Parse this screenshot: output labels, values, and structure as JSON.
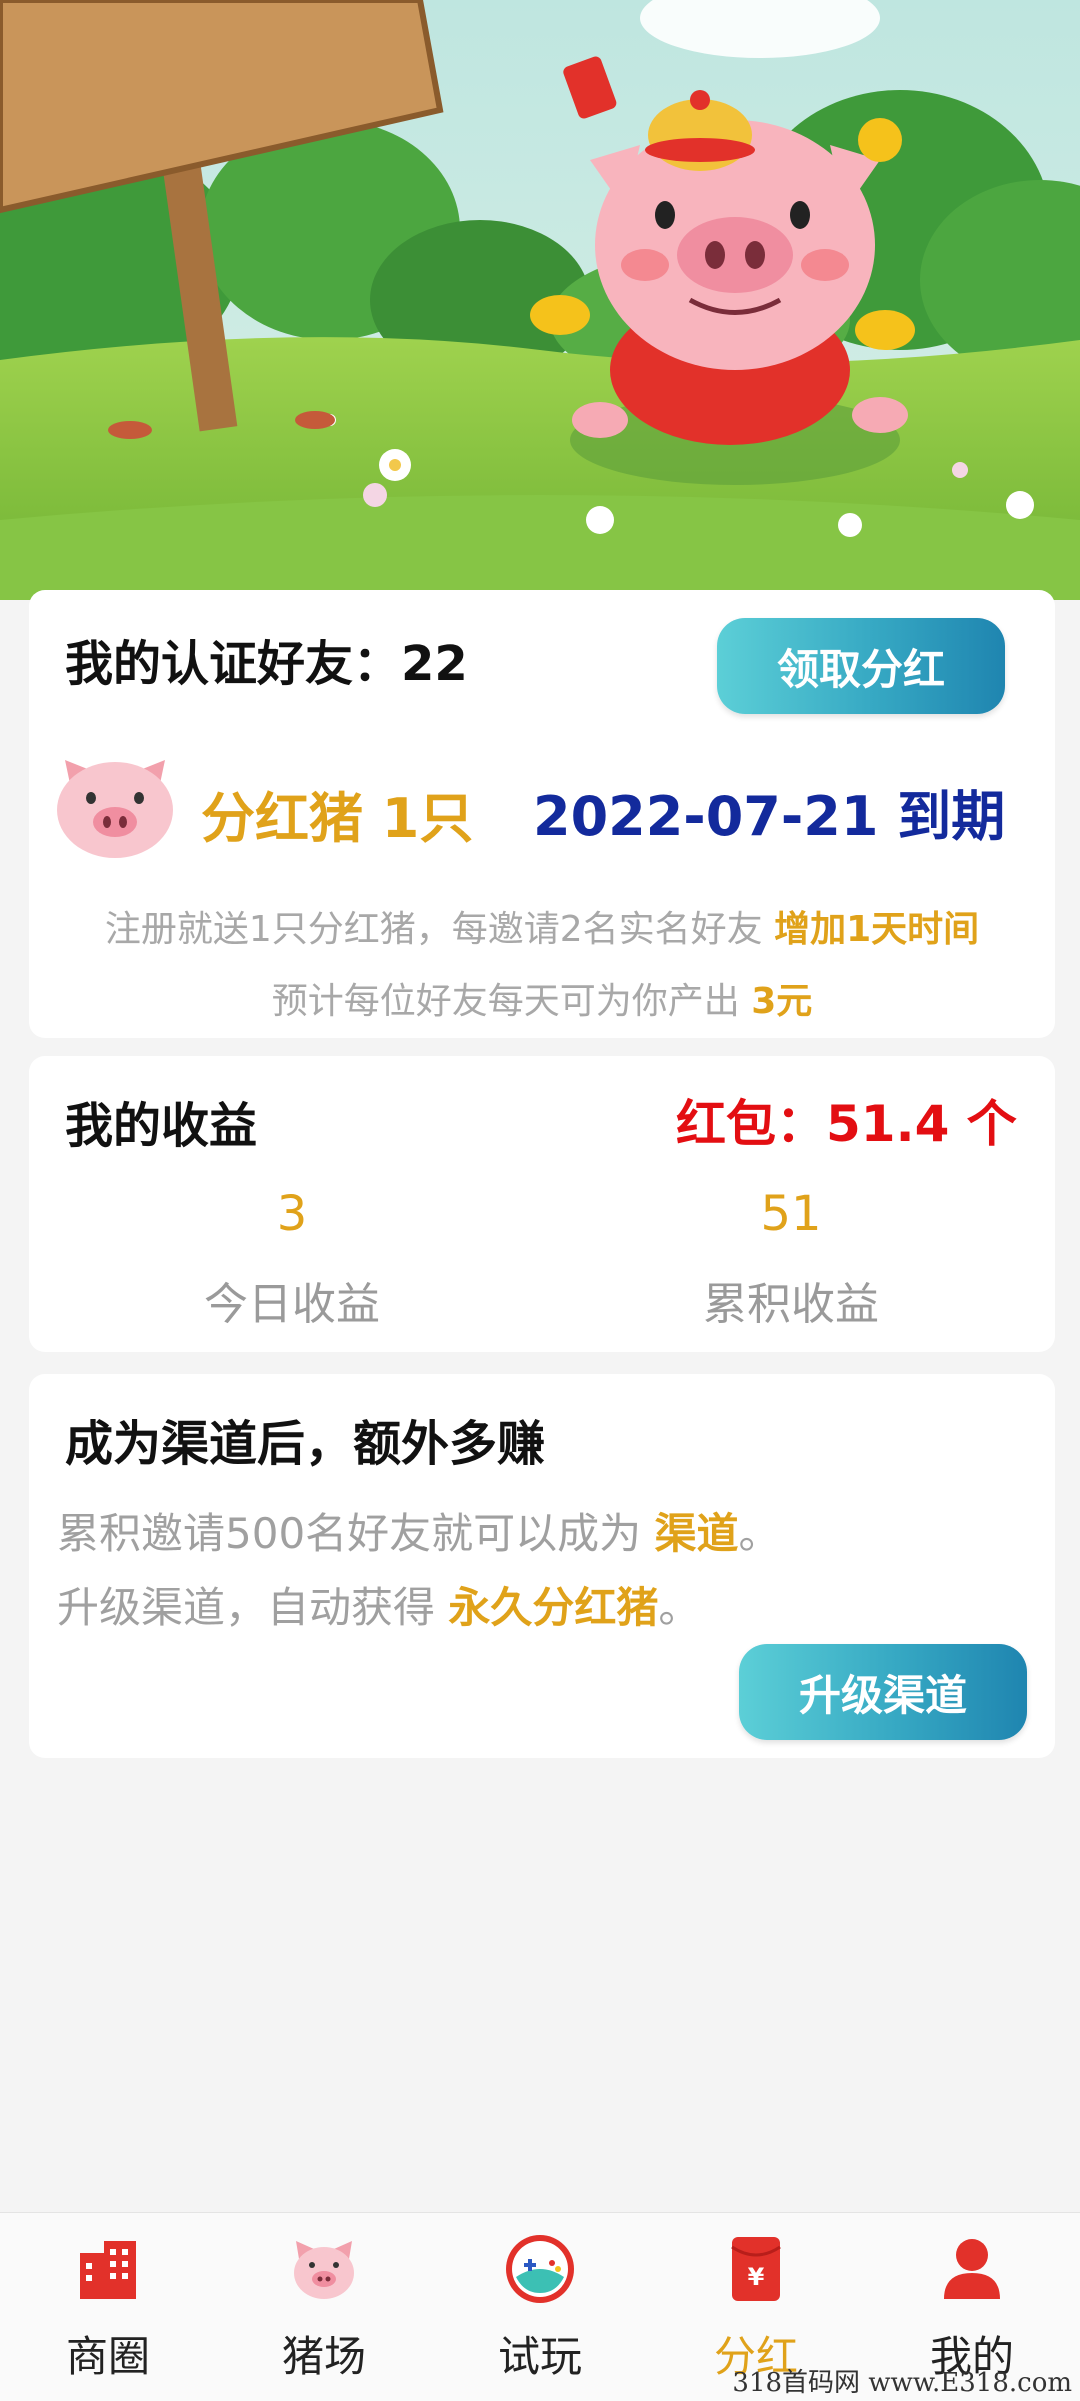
{
  "card_friends": {
    "title_label": "我的认证好友：22",
    "claim_button": "领取分红",
    "pig_count": "分红猪 1只",
    "expiry": "2022-07-21 到期",
    "note1_text": "注册就送1只分红猪，每邀请2名实名好友",
    "note1_highlight": "增加1天时间",
    "note2_text": "预计每位好友每天可为你产出",
    "note2_highlight": "3元"
  },
  "card_earnings": {
    "title": "我的收益",
    "red_packet": "红包：51.4 个",
    "today_value": "3",
    "today_label": "今日收益",
    "total_value": "51",
    "total_label": "累积收益"
  },
  "card_channel": {
    "title": "成为渠道后，额外多赚",
    "line1_text": "累积邀请500名好友就可以成为",
    "line1_highlight": "渠道",
    "line1_end": "。",
    "line2_text": "升级渠道，自动获得",
    "line2_highlight": "永久分红猪",
    "line2_end": "。",
    "upgrade_button": "升级渠道"
  },
  "tabbar": {
    "items": [
      {
        "label": "商圈",
        "icon": "building-icon"
      },
      {
        "label": "猪场",
        "icon": "pig-face-icon"
      },
      {
        "label": "试玩",
        "icon": "gamepad-icon"
      },
      {
        "label": "分红",
        "icon": "red-envelope-icon"
      },
      {
        "label": "我的",
        "icon": "user-icon"
      }
    ],
    "active_index": 3
  },
  "watermark": "318首码网 www.E318.com",
  "colors": {
    "accent_gold": "#e0a21a",
    "expiry_blue": "#132a9c",
    "red": "#e30e12",
    "button_teal": "#36a8c3"
  }
}
